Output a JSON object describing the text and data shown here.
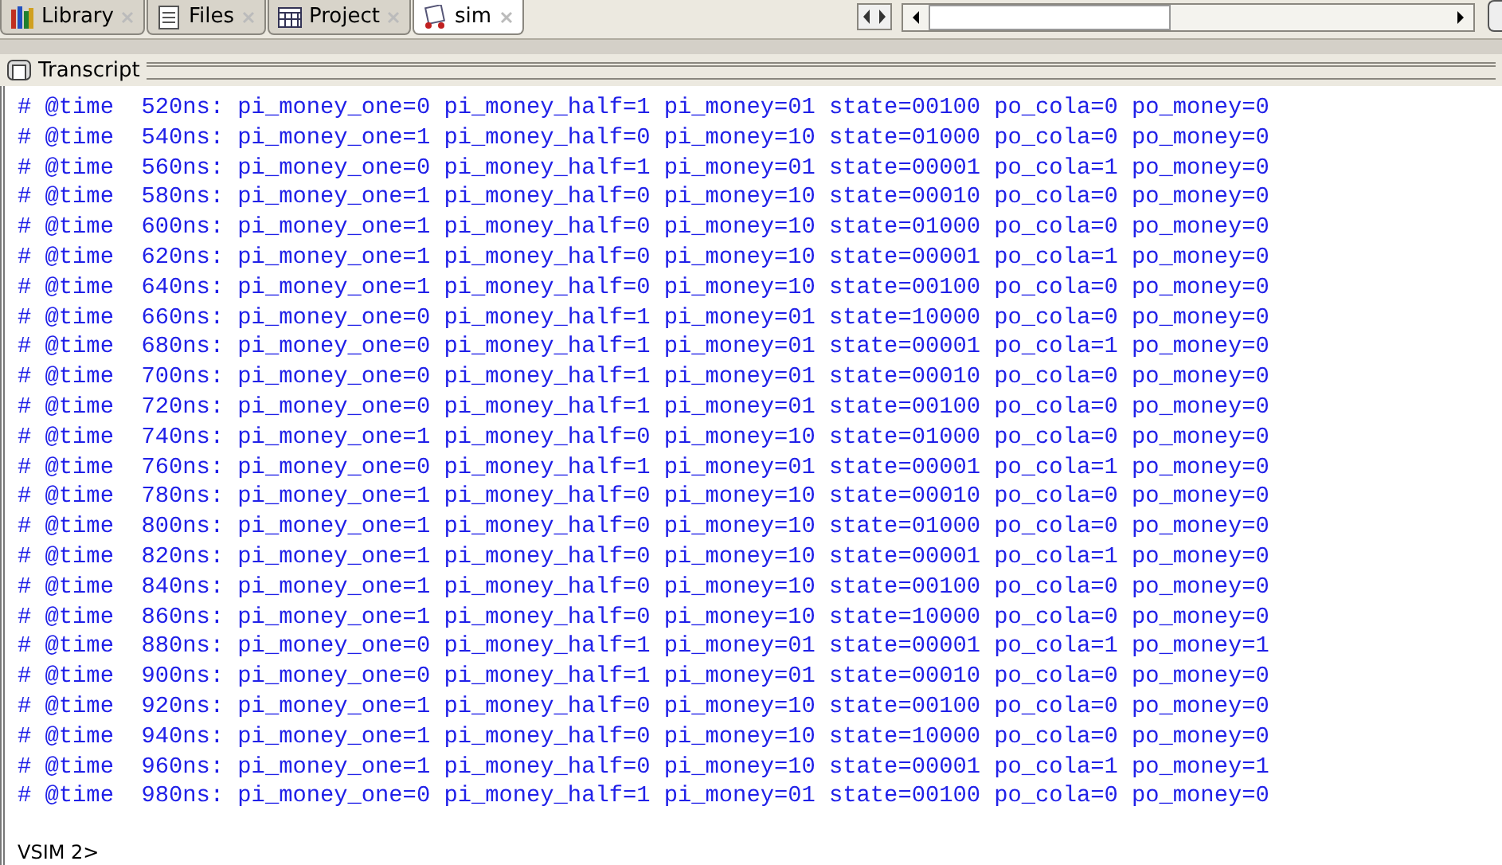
{
  "tabs": [
    {
      "label": "Library",
      "selected": false
    },
    {
      "label": "Files",
      "selected": false
    },
    {
      "label": "Project",
      "selected": false
    },
    {
      "label": "sim",
      "selected": true
    }
  ],
  "transcript": {
    "title": "Transcript",
    "lines": [
      "# @time  520ns: pi_money_one=0 pi_money_half=1 pi_money=01 state=00100 po_cola=0 po_money=0",
      "# @time  540ns: pi_money_one=1 pi_money_half=0 pi_money=10 state=01000 po_cola=0 po_money=0",
      "# @time  560ns: pi_money_one=0 pi_money_half=1 pi_money=01 state=00001 po_cola=1 po_money=0",
      "# @time  580ns: pi_money_one=1 pi_money_half=0 pi_money=10 state=00010 po_cola=0 po_money=0",
      "# @time  600ns: pi_money_one=1 pi_money_half=0 pi_money=10 state=01000 po_cola=0 po_money=0",
      "# @time  620ns: pi_money_one=1 pi_money_half=0 pi_money=10 state=00001 po_cola=1 po_money=0",
      "# @time  640ns: pi_money_one=1 pi_money_half=0 pi_money=10 state=00100 po_cola=0 po_money=0",
      "# @time  660ns: pi_money_one=0 pi_money_half=1 pi_money=01 state=10000 po_cola=0 po_money=0",
      "# @time  680ns: pi_money_one=0 pi_money_half=1 pi_money=01 state=00001 po_cola=1 po_money=0",
      "# @time  700ns: pi_money_one=0 pi_money_half=1 pi_money=01 state=00010 po_cola=0 po_money=0",
      "# @time  720ns: pi_money_one=0 pi_money_half=1 pi_money=01 state=00100 po_cola=0 po_money=0",
      "# @time  740ns: pi_money_one=1 pi_money_half=0 pi_money=10 state=01000 po_cola=0 po_money=0",
      "# @time  760ns: pi_money_one=0 pi_money_half=1 pi_money=01 state=00001 po_cola=1 po_money=0",
      "# @time  780ns: pi_money_one=1 pi_money_half=0 pi_money=10 state=00010 po_cola=0 po_money=0",
      "# @time  800ns: pi_money_one=1 pi_money_half=0 pi_money=10 state=01000 po_cola=0 po_money=0",
      "# @time  820ns: pi_money_one=1 pi_money_half=0 pi_money=10 state=00001 po_cola=1 po_money=0",
      "# @time  840ns: pi_money_one=1 pi_money_half=0 pi_money=10 state=00100 po_cola=0 po_money=0",
      "# @time  860ns: pi_money_one=1 pi_money_half=0 pi_money=10 state=10000 po_cola=0 po_money=0",
      "# @time  880ns: pi_money_one=0 pi_money_half=1 pi_money=01 state=00001 po_cola=1 po_money=1",
      "# @time  900ns: pi_money_one=0 pi_money_half=1 pi_money=01 state=00010 po_cola=0 po_money=0",
      "# @time  920ns: pi_money_one=1 pi_money_half=0 pi_money=10 state=00100 po_cola=0 po_money=0",
      "# @time  940ns: pi_money_one=1 pi_money_half=0 pi_money=10 state=10000 po_cola=0 po_money=0",
      "# @time  960ns: pi_money_one=1 pi_money_half=0 pi_money=10 state=00001 po_cola=1 po_money=1",
      "# @time  980ns: pi_money_one=0 pi_money_half=1 pi_money=01 state=00100 po_cola=0 po_money=0"
    ],
    "prompt": "VSIM 2>"
  }
}
